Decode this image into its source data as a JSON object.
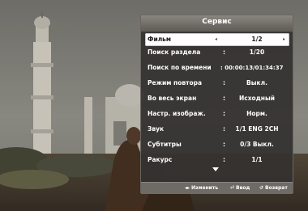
{
  "menu": {
    "title": "Сервис",
    "rows": [
      {
        "label": "Фильм",
        "value": "1/2"
      },
      {
        "label": "Поиск раздела",
        "value": "1/20"
      },
      {
        "label": "Поиск по времени",
        "value": ": 00:00:13/01:34:37"
      },
      {
        "label": "Режим повтора",
        "value": "Выкл."
      },
      {
        "label": "Во весь экран",
        "value": "Исходный"
      },
      {
        "label": "Настр. изображ.",
        "value": "Норм."
      },
      {
        "label": "Звук",
        "value": "1/1 ENG 2CH"
      },
      {
        "label": "Субтитры",
        "value": "0/3 Выкл."
      },
      {
        "label": "Ракурс",
        "value": "1/1"
      }
    ],
    "colon": ":",
    "footer": {
      "change_icon": "◂▸",
      "change_label": "Изменить",
      "enter_icon": "⏎",
      "enter_label": "Ввод",
      "return_icon": "↺",
      "return_label": "Возврат"
    },
    "arrow_left": "◂",
    "arrow_right": "▸"
  }
}
